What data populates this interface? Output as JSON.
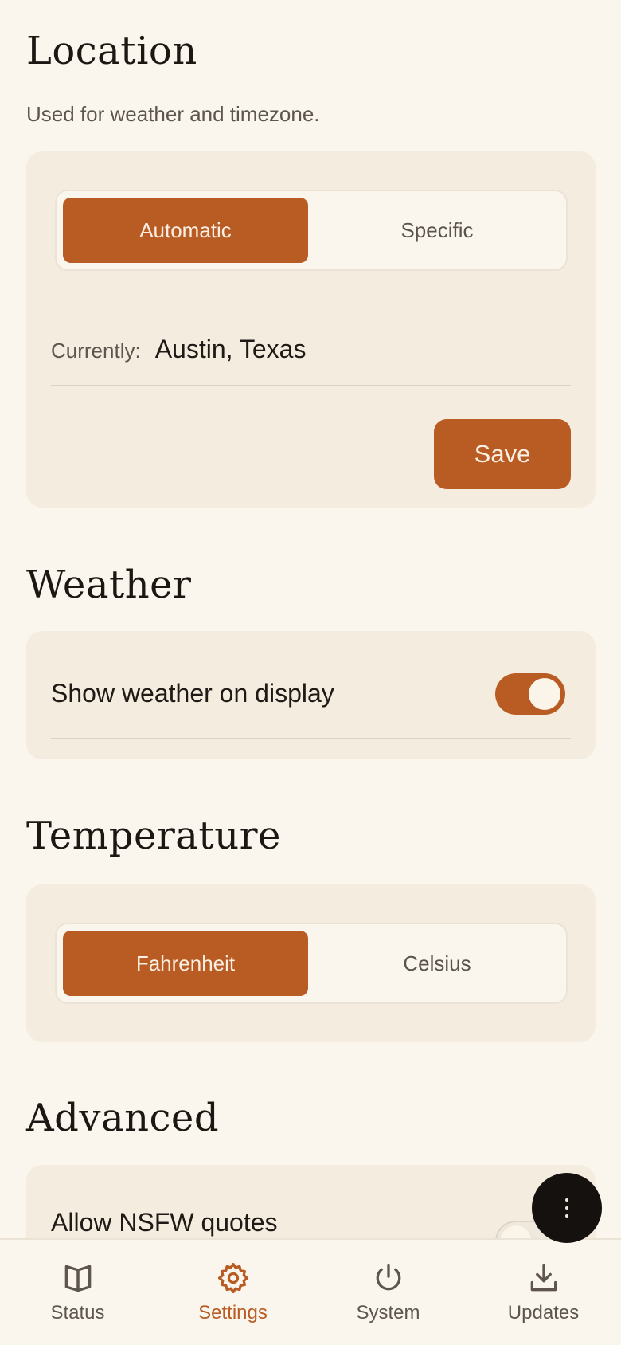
{
  "location": {
    "title": "Location",
    "subtitle": "Used for weather and timezone.",
    "modes": [
      {
        "label": "Automatic",
        "active": true
      },
      {
        "label": "Specific",
        "active": false
      }
    ],
    "current_label": "Currently:",
    "current_value": "Austin, Texas",
    "save_label": "Save"
  },
  "weather": {
    "title": "Weather",
    "show_label": "Show weather on display",
    "show_enabled": true
  },
  "temperature": {
    "title": "Temperature",
    "units": [
      {
        "label": "Fahrenheit",
        "active": true
      },
      {
        "label": "Celsius",
        "active": false
      }
    ]
  },
  "advanced": {
    "title": "Advanced",
    "nsfw_label": "Allow NSFW quotes",
    "nsfw_enabled": false
  },
  "fab": {
    "icon": "more-vertical-icon"
  },
  "nav": {
    "items": [
      {
        "label": "Status",
        "icon": "book-open-icon",
        "active": false
      },
      {
        "label": "Settings",
        "icon": "gear-icon",
        "active": true
      },
      {
        "label": "System",
        "icon": "power-icon",
        "active": false
      },
      {
        "label": "Updates",
        "icon": "download-icon",
        "active": false
      }
    ]
  },
  "colors": {
    "accent": "#b95c23",
    "background": "#faf6ee",
    "card": "#f3ecdf",
    "fab": "#15110e"
  }
}
